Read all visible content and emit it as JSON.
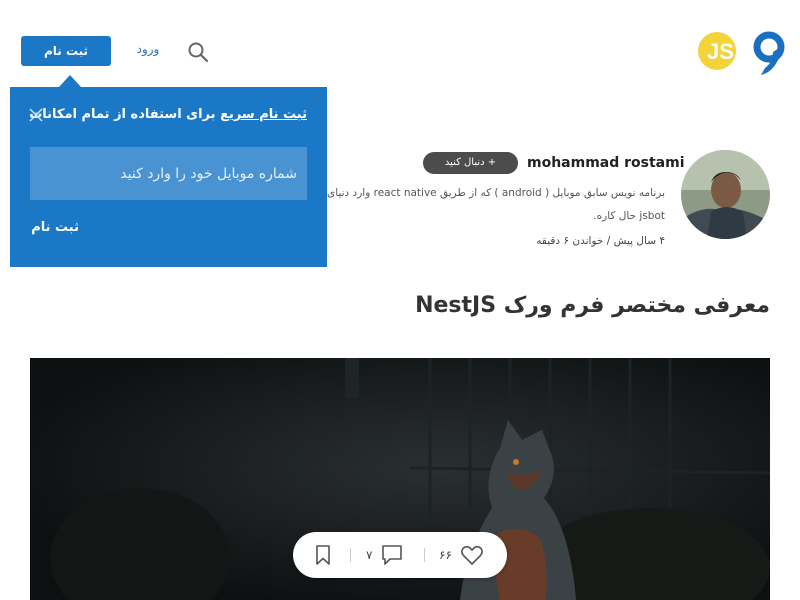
{
  "header": {
    "login_label": "ورود",
    "signup_label": "ثبت نام"
  },
  "popup": {
    "title_highlight": "ثبت نام سریع",
    "title_rest": " برای استفاده از تمام امکانات",
    "phone_placeholder": "شماره موبایل خود را وارد کنید",
    "submit_label": "ثبت نام"
  },
  "author": {
    "name": "mohammad rostami",
    "follow_label": "+ دنبال کنید",
    "bio": "برنامه نویس سابق موبایل ( android ) که از طریق react native وارد دنیای jsbot حال کاره.",
    "meta": "۴ سال پیش / خواندن ۶ دقیقه"
  },
  "article": {
    "title": "معرفی مختصر فرم ورک NestJS"
  },
  "actions": {
    "likes": "۶۶",
    "comments": "۷"
  },
  "colors": {
    "brand_blue": "#1a78c6",
    "logo_yellow": "#f2d33a"
  },
  "icons": [
    "logo-icon",
    "search-icon",
    "close-icon",
    "heart-icon",
    "comment-icon",
    "bookmark-icon"
  ]
}
